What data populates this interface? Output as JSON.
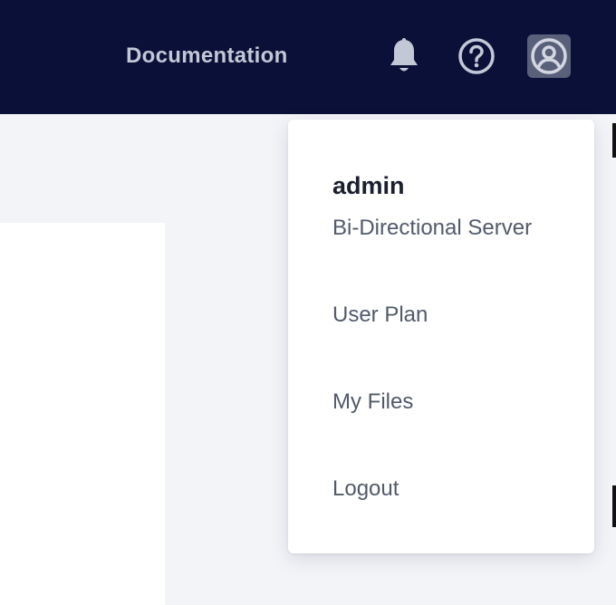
{
  "header": {
    "documentation_label": "Documentation",
    "icons": {
      "notifications": "bell-icon",
      "help": "help-circle-icon",
      "account": "user-circle-icon"
    },
    "colors": {
      "background": "#0b1038",
      "icon": "#c3c8d6",
      "active_icon_bg": "#59607a"
    }
  },
  "user_menu": {
    "username": "admin",
    "server": "Bi-Directional Server",
    "items": [
      {
        "label": "User Plan"
      },
      {
        "label": "My Files"
      },
      {
        "label": "Logout"
      }
    ]
  }
}
